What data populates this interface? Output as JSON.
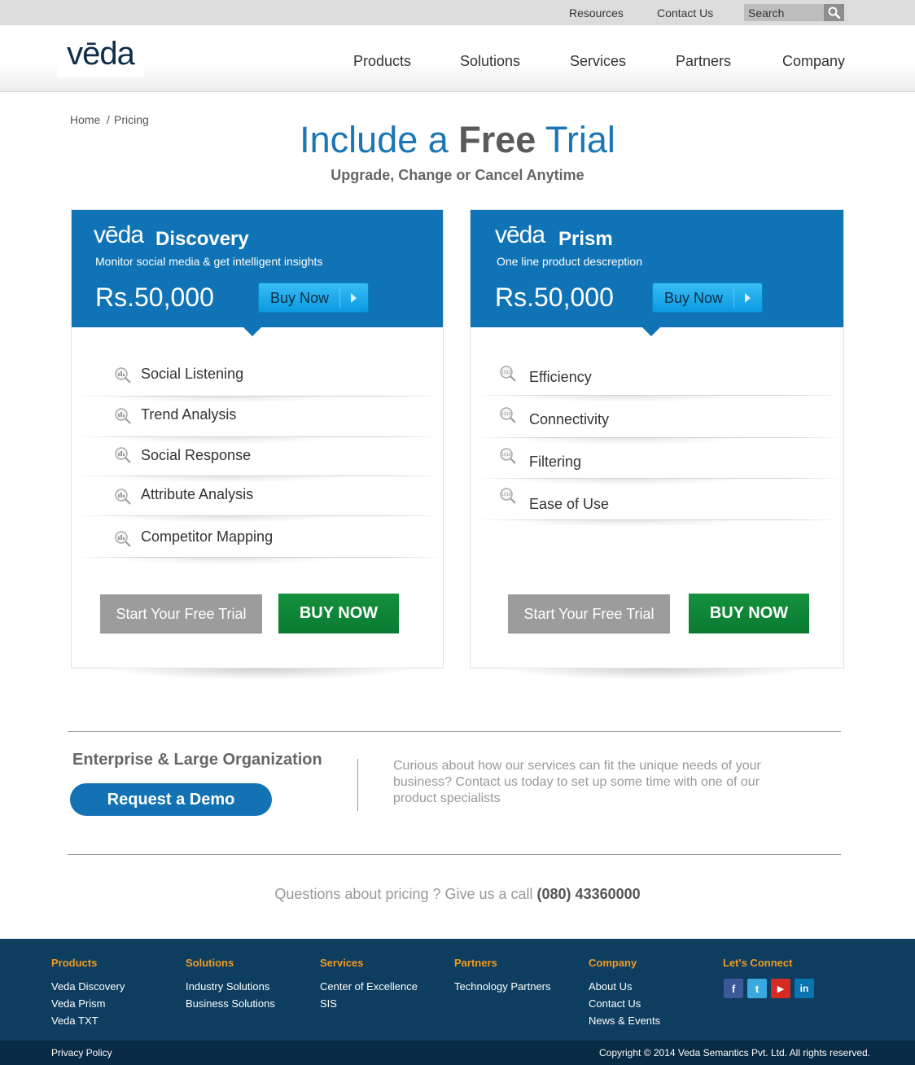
{
  "topbar": {
    "links": [
      "Resources",
      "Contact Us"
    ],
    "search_placeholder": "Search"
  },
  "header": {
    "logo_text": "vēda",
    "nav": [
      "Products",
      "Solutions",
      "Services",
      "Partners",
      "Company"
    ]
  },
  "breadcrumb": {
    "home": "Home",
    "sep": "/",
    "current": "Pricing"
  },
  "hero": {
    "title_a": "Include a ",
    "title_b": "Free",
    "title_c": " Trial",
    "subtitle": "Upgrade, Change or Cancel Anytime"
  },
  "cards": [
    {
      "brand": "vēda",
      "name": "Discovery",
      "desc": "Monitor social media & get intelligent insights",
      "price": "Rs.50,000",
      "buy_label": "Buy Now",
      "features": [
        "Social Listening",
        "Trend Analysis",
        "Social Response",
        "Attribute Analysis",
        "Competitor Mapping"
      ],
      "trial_label": "Start Your Free Trial",
      "buynow_label": "BUY NOW"
    },
    {
      "brand": "vēda",
      "name": "Prism",
      "desc": "One line product descreption",
      "price": "Rs.50,000",
      "buy_label": "Buy Now",
      "features": [
        "Efficiency",
        "Connectivity",
        "Filtering",
        "Ease of Use"
      ],
      "trial_label": "Start Your Free Trial",
      "buynow_label": "BUY NOW"
    }
  ],
  "enterprise": {
    "title": "Enterprise & Large Organization",
    "demo_label": "Request a Demo",
    "text": "Curious about how our services can fit the unique needs of your business? Contact us today to set up some time with one of our product specialists"
  },
  "call": {
    "text": "Questions about pricing ?  Give us a call ",
    "phone": "(080) 43360000"
  },
  "footer": {
    "columns": [
      {
        "heading": "Products",
        "links": [
          "Veda Discovery",
          "Veda Prism",
          "Veda TXT"
        ]
      },
      {
        "heading": "Solutions",
        "links": [
          "Industry Solutions",
          "Business Solutions"
        ]
      },
      {
        "heading": "Services",
        "links": [
          "Center of Excellence",
          "SIS"
        ]
      },
      {
        "heading": "Partners",
        "links": [
          "Technology Partners"
        ]
      },
      {
        "heading": "Company",
        "links": [
          "About Us",
          "Contact Us",
          "News & Events"
        ]
      }
    ],
    "connect_heading": "Let's Connect",
    "social": [
      {
        "icon": "facebook-icon",
        "glyph": "f",
        "color": "#3b5998"
      },
      {
        "icon": "twitter-icon",
        "glyph": "t",
        "color": "#3aa9e0"
      },
      {
        "icon": "youtube-icon",
        "glyph": "▶",
        "color": "#d52b22"
      },
      {
        "icon": "linkedin-icon",
        "glyph": "in",
        "color": "#0a74b0"
      }
    ],
    "privacy": "Privacy Policy",
    "copyright": "Copyright © 2014 Veda Semantics Pvt. Ltd. All rights reserved."
  }
}
